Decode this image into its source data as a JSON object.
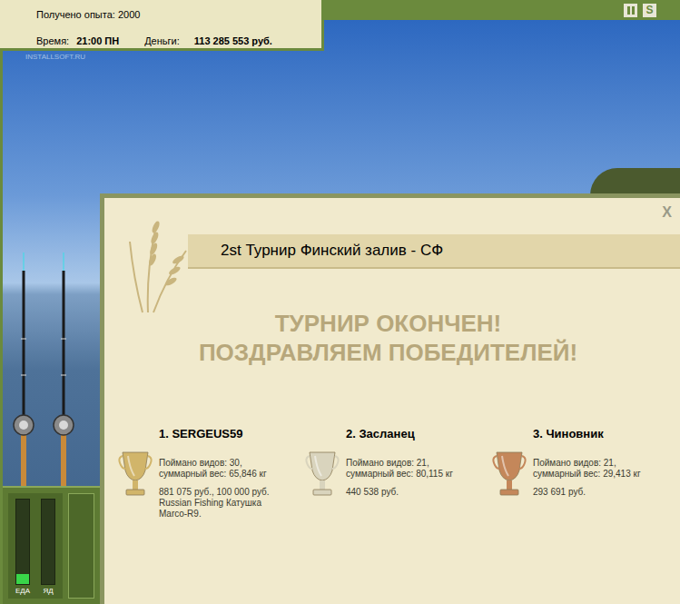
{
  "hud": {
    "experience": "Получено опыта: 2000",
    "time_label": "Время:",
    "time": "21:00 ПН",
    "money_label": "Деньги:",
    "money": "113 285 553 руб."
  },
  "watermark": "INSTALLSOFT.RU",
  "toolbar": {
    "settings_key": "S"
  },
  "gauges": [
    {
      "label": "ЕДА",
      "level": 0.12
    },
    {
      "label": "ЯД",
      "level": 0
    }
  ],
  "dialog": {
    "title": "2st Турнир Финский залив - СФ",
    "close": "X",
    "headline": [
      "ТУРНИР ОКОНЧЕН!",
      "ПОЗДРАВЛЯЕМ ПОБЕДИТЕЛЕЙ!"
    ],
    "winners": [
      {
        "place": "1. SERGEUS59",
        "species": "Поймано видов: 30,",
        "weight": "суммарный вес: 65,846 кг",
        "prize": [
          "881 075 руб., 100 000 руб.",
          "Russian Fishing Катушка",
          "Marco-R9."
        ],
        "color": "#d1b56a"
      },
      {
        "place": "2. Засланец",
        "species": "Поймано видов: 21,",
        "weight": "суммарный вес: 80,115 кг",
        "prize": [
          "440 538 руб."
        ],
        "color": "#d9d4bd"
      },
      {
        "place": "3. Чиновник",
        "species": "Поймано видов: 21,",
        "weight": "суммарный вес: 29,413 кг",
        "prize": [
          "293 691 руб."
        ],
        "color": "#c4875a"
      }
    ]
  }
}
